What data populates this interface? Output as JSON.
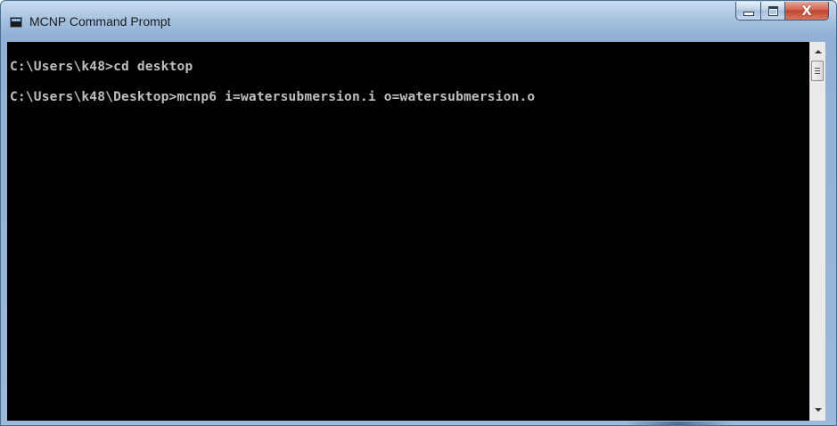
{
  "window": {
    "title": "MCNP Command Prompt",
    "title_icon": "console-icon",
    "buttons": {
      "minimize_icon": "minimize-icon",
      "maximize_icon": "maximize-icon",
      "close_icon": "close-icon",
      "close_glyph": "X"
    }
  },
  "console": {
    "lines": [
      "C:\\Users\\k48>cd desktop",
      "C:\\Users\\k48\\Desktop>mcnp6 i=watersubmersion.i o=watersubmersion.o"
    ],
    "background_color": "#000000",
    "text_color": "#c0c0c0"
  },
  "scrollbar": {
    "up_icon": "scroll-up-arrow-icon",
    "down_icon": "scroll-down-arrow-icon",
    "thumb_icon": "scroll-thumb-grip-icon"
  },
  "colors": {
    "frame": "#a8c4e1",
    "close_button": "#c2432c"
  }
}
